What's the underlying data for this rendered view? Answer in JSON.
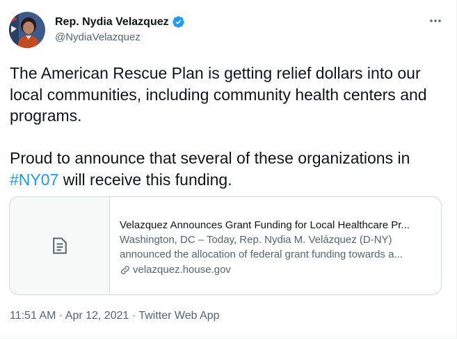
{
  "author": {
    "name": "Rep. Nydia Velazquez",
    "handle": "@NydiaVelazquez"
  },
  "tweet": {
    "paragraph1": "The American Rescue Plan is getting relief dollars into our local communities, including community health centers and programs.",
    "paragraph2_before": "Proud to announce that several of these organizations in ",
    "hashtag": "#NY07",
    "paragraph2_after": " will receive this funding."
  },
  "card": {
    "title": "Velazquez Announces Grant Funding for Local Healthcare Pr...",
    "description_line1": "Washington, DC – Today, Rep. Nydia M. Velázquez (D-NY)",
    "description_line2": "announced the allocation of federal grant funding towards a...",
    "domain": "velazquez.house.gov"
  },
  "meta": {
    "time": "11:51 AM",
    "separator1": " · ",
    "date": "Apr 12, 2021",
    "separator2": " · ",
    "source": "Twitter Web App"
  },
  "colors": {
    "link": "#1d9bf0",
    "verified": "#1d9bf0",
    "secondary_text": "#536471",
    "primary_text": "#0f1419"
  },
  "icons": {
    "verified": "verified-badge-icon",
    "more": "more-dots-icon",
    "card_thumb": "document-icon",
    "link": "link-icon"
  }
}
